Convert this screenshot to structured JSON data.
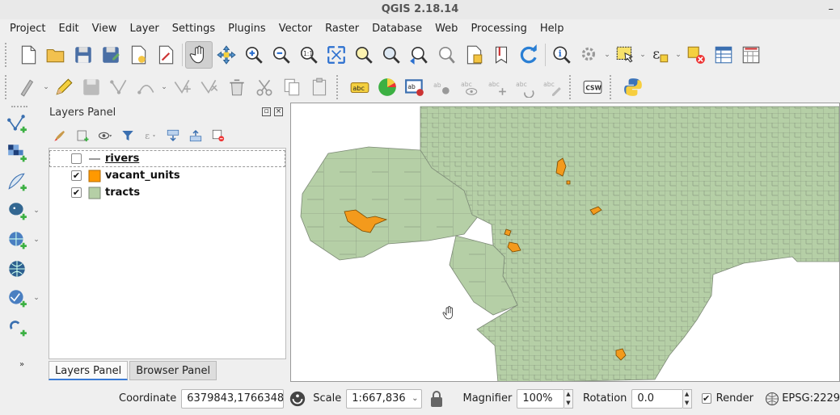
{
  "window": {
    "title": "QGIS 2.18.14",
    "minimize": "–"
  },
  "menu": [
    "Project",
    "Edit",
    "View",
    "Layer",
    "Settings",
    "Plugins",
    "Vector",
    "Raster",
    "Database",
    "Web",
    "Processing",
    "Help"
  ],
  "toolbar": {
    "csw_label": "CSW",
    "label_tool": "abc"
  },
  "layers_panel": {
    "title": "Layers Panel",
    "layers": [
      {
        "name": "rivers",
        "checked": false,
        "symbol": "line",
        "color": "#555555"
      },
      {
        "name": "vacant_units",
        "checked": true,
        "symbol": "fill",
        "color": "#ff9900"
      },
      {
        "name": "tracts",
        "checked": true,
        "symbol": "fill",
        "color": "#b5cfa6"
      }
    ],
    "tabs": [
      "Layers Panel",
      "Browser Panel"
    ]
  },
  "map": {
    "background": "#ffffff",
    "tract_fill": "#b5cfa6",
    "tract_stroke": "#7d8a77",
    "vacant_fill": "#f39a1c"
  },
  "status": {
    "coordinate_label": "Coordinate",
    "coordinate_value": "6379843,1766348",
    "scale_label": "Scale",
    "scale_value": "1:667,836",
    "magnifier_label": "Magnifier",
    "magnifier_value": "100%",
    "rotation_label": "Rotation",
    "rotation_value": "0.0",
    "render_label": "Render",
    "render_checked": true,
    "crs": "EPSG:2229"
  }
}
